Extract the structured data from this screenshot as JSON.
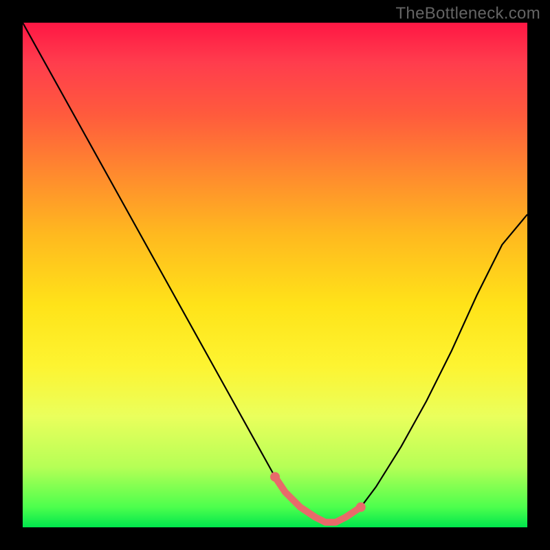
{
  "watermark": "TheBottleneck.com",
  "chart_data": {
    "type": "line",
    "title": "",
    "xlabel": "",
    "ylabel": "",
    "xlim": [
      0,
      100
    ],
    "ylim": [
      0,
      100
    ],
    "series": [
      {
        "name": "main-curve",
        "x": [
          0,
          5,
          10,
          15,
          20,
          25,
          30,
          35,
          40,
          45,
          50,
          52,
          55,
          58,
          60,
          62,
          64,
          67,
          70,
          75,
          80,
          85,
          90,
          95,
          100
        ],
        "y": [
          100,
          91,
          82,
          73,
          64,
          55,
          46,
          37,
          28,
          19,
          10,
          7,
          4,
          2,
          1,
          1,
          2,
          4,
          8,
          16,
          25,
          35,
          46,
          56,
          62
        ]
      },
      {
        "name": "highlight-segment",
        "x": [
          50,
          52,
          55,
          58,
          60,
          62,
          64,
          67
        ],
        "y": [
          10,
          7,
          4,
          2,
          1,
          1,
          2,
          4
        ]
      }
    ],
    "highlight_points": {
      "x": [
        50,
        67
      ],
      "y": [
        10,
        4
      ]
    },
    "background_gradient": {
      "top_color": "#ff1744",
      "bottom_color": "#00e64d"
    }
  }
}
